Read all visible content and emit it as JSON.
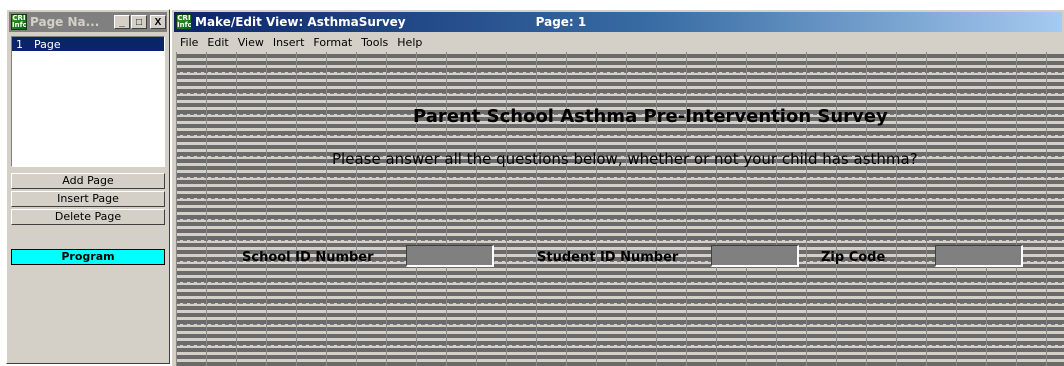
{
  "left_window": {
    "title": "Page Na...",
    "icon": "app-icon",
    "window_buttons": {
      "minimize": "_",
      "maximize": "□",
      "close": "X"
    },
    "page_list": [
      {
        "number": "1",
        "name": "Page"
      }
    ],
    "buttons": {
      "add_page": "Add Page",
      "insert_page": "Insert Page",
      "delete_page": "Delete Page",
      "program": "Program"
    }
  },
  "right_window": {
    "title": "Make/Edit View: AsthmaSurvey",
    "page_label": "Page: 1",
    "icon": "app-icon",
    "menu": [
      "File",
      "Edit",
      "View",
      "Insert",
      "Format",
      "Tools",
      "Help"
    ],
    "canvas": {
      "survey_title": "Parent School Asthma Pre-Intervention Survey",
      "instructions": "Please answer all the questions below, whether or not your child has asthma?",
      "fields": [
        {
          "label": "School ID Number",
          "value": ""
        },
        {
          "label": "Student ID Number",
          "value": ""
        },
        {
          "label": "Zip Code",
          "value": ""
        }
      ]
    }
  },
  "colors": {
    "active_titlebar": "#0a246a",
    "inactive_titlebar": "#808080",
    "program_button": "#00ffff",
    "window_face": "#d4d0c8",
    "field_fill": "#808080"
  }
}
